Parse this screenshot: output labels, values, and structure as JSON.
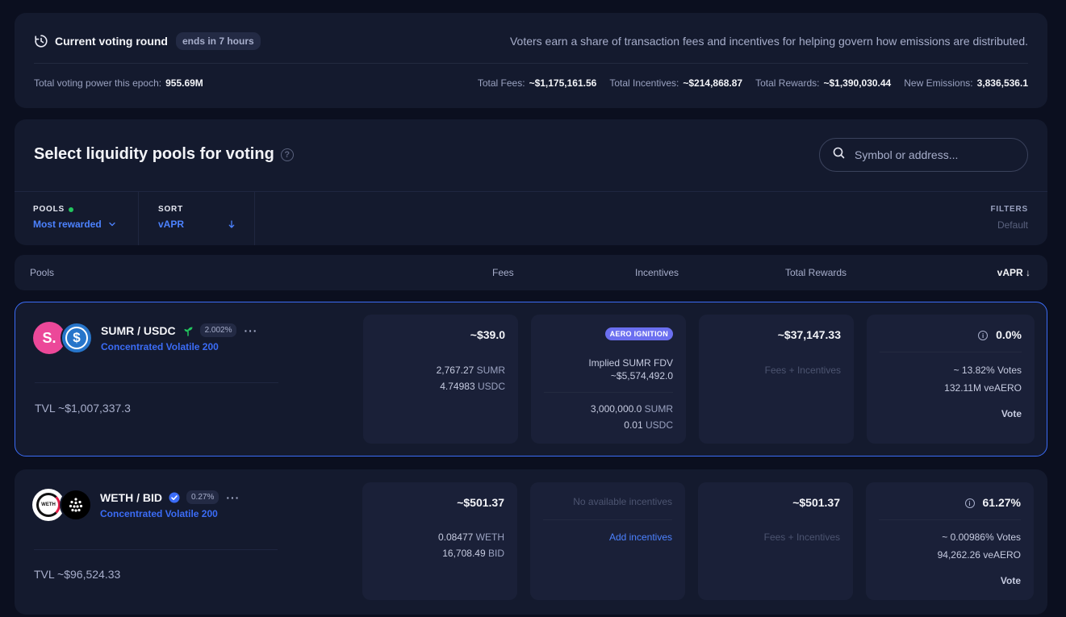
{
  "round": {
    "title": "Current voting round",
    "ends_badge": "ends in 7 hours",
    "description": "Voters earn a share of transaction fees and incentives for helping govern how emissions are distributed.",
    "power_label": "Total voting power this epoch:",
    "power_value": "955.69M",
    "stats": [
      {
        "label": "Total Fees:",
        "value": "~$1,175,161.56"
      },
      {
        "label": "Total Incentives:",
        "value": "~$214,868.87"
      },
      {
        "label": "Total Rewards:",
        "value": "~$1,390,030.44"
      },
      {
        "label": "New Emissions:",
        "value": "3,836,536.1"
      }
    ]
  },
  "select": {
    "title": "Select liquidity pools for voting",
    "help": "?",
    "search_placeholder": "Symbol or address...",
    "pools_label": "POOLS",
    "pools_value": "Most rewarded",
    "sort_label": "SORT",
    "sort_value": "vAPR",
    "filters_label": "FILTERS",
    "filters_value": "Default"
  },
  "columns": {
    "pools": "Pools",
    "fees": "Fees",
    "incentives": "Incentives",
    "total_rewards": "Total Rewards",
    "vapr": "vAPR ↓"
  },
  "pools": [
    {
      "pair": "SUMR / USDC",
      "fee": "2.002%",
      "type": "Concentrated Volatile 200",
      "tvl": "TVL ~$1,007,337.3",
      "fees_total": "~$39.0",
      "fees_lines": [
        {
          "num": "2,767.27",
          "sym": "SUMR"
        },
        {
          "num": "4.74983",
          "sym": "USDC"
        }
      ],
      "aero_badge": "AERO IGNITION",
      "fdv_label": "Implied SUMR FDV",
      "fdv_value": "~$5,574,492.0",
      "inc_lines": [
        {
          "num": "3,000,000.0",
          "sym": "SUMR"
        },
        {
          "num": "0.01",
          "sym": "USDC"
        }
      ],
      "rewards_total": "~$37,147.33",
      "rewards_note": "Fees + Incentives",
      "vapr": "0.0%",
      "votes_pct": "~ 13.82% Votes",
      "ve_votes": "132.11M veAERO",
      "vote_label": "Vote"
    },
    {
      "pair": "WETH / BID",
      "fee": "0.27%",
      "type": "Concentrated Volatile 200",
      "tvl": "TVL ~$96,524.33",
      "fees_total": "~$501.37",
      "fees_lines": [
        {
          "num": "0.08477",
          "sym": "WETH"
        },
        {
          "num": "16,708.49",
          "sym": "BID"
        }
      ],
      "no_incentives": "No available incentives",
      "add_incentives": "Add incentives",
      "rewards_total": "~$501.37",
      "rewards_note": "Fees + Incentives",
      "vapr": "61.27%",
      "votes_pct": "~ 0.00986% Votes",
      "ve_votes": "94,262.26 veAERO",
      "vote_label": "Vote"
    }
  ],
  "logos": {
    "sumr_letter": "S.",
    "usdc_symbol": "$",
    "weth_text": "WETH",
    "sumr_color": "#ec4899",
    "usdc_color": "#2775ca"
  },
  "colors": {
    "accent": "#3b6cf6",
    "link": "#4c82ff",
    "positive": "#22c55e",
    "aero_badge": "#6b6ff0"
  }
}
